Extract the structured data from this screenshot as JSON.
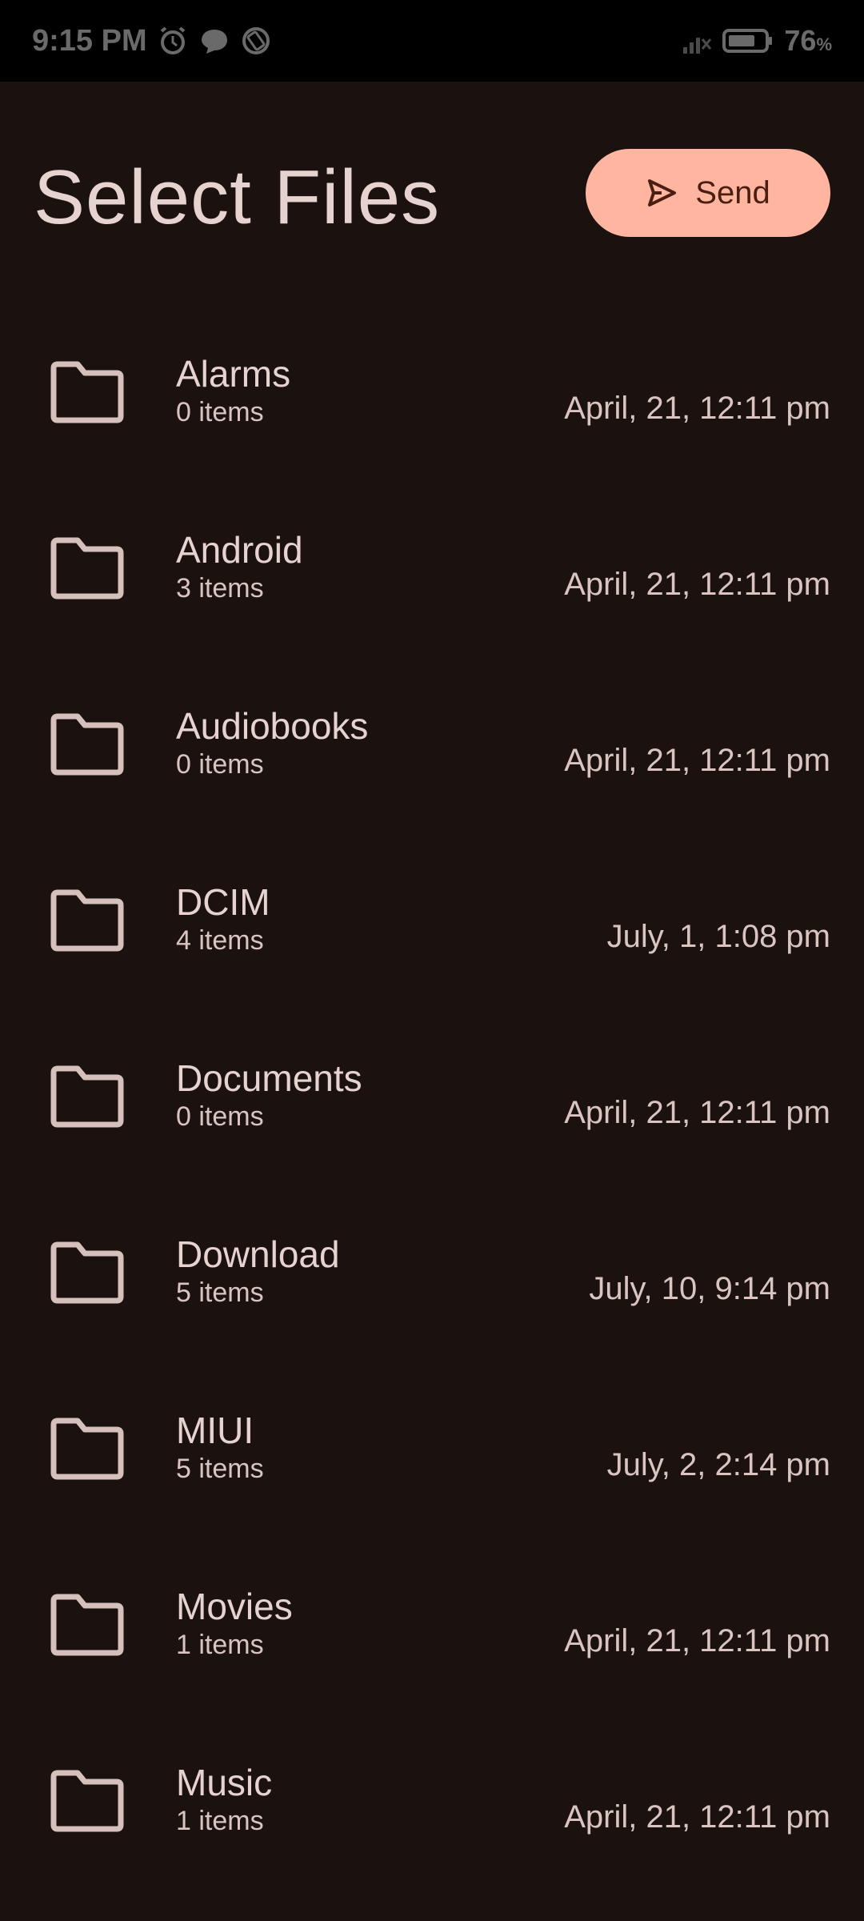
{
  "status_bar": {
    "time": "9:15 PM",
    "battery_percent": "76",
    "battery_suffix": "%",
    "icons": [
      "alarm-icon",
      "chat-icon",
      "rotate-icon",
      "signal-icon",
      "battery-icon"
    ]
  },
  "header": {
    "title": "Select Files",
    "send_label": "Send"
  },
  "colors": {
    "background": "#1b1210",
    "accent": "#ffb59f",
    "text": "#e6d3cf"
  },
  "files": [
    {
      "name": "Alarms",
      "count": "0 items",
      "date": "April, 21, 12:11 pm"
    },
    {
      "name": "Android",
      "count": "3 items",
      "date": "April, 21, 12:11 pm"
    },
    {
      "name": "Audiobooks",
      "count": "0 items",
      "date": "April, 21, 12:11 pm"
    },
    {
      "name": "DCIM",
      "count": "4 items",
      "date": "July, 1, 1:08 pm"
    },
    {
      "name": "Documents",
      "count": "0 items",
      "date": "April, 21, 12:11 pm"
    },
    {
      "name": "Download",
      "count": "5 items",
      "date": "July, 10, 9:14 pm"
    },
    {
      "name": "MIUI",
      "count": "5 items",
      "date": "July, 2, 2:14 pm"
    },
    {
      "name": "Movies",
      "count": "1 items",
      "date": "April, 21, 12:11 pm"
    },
    {
      "name": "Music",
      "count": "1 items",
      "date": "April, 21, 12:11 pm"
    }
  ]
}
